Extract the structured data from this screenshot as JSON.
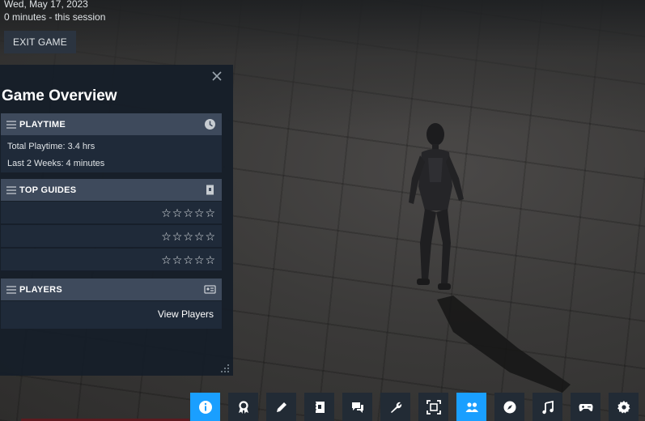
{
  "session": {
    "date": "Wed, May 17, 2023",
    "duration": "0 minutes - this session",
    "exit_label": "EXIT GAME"
  },
  "panel": {
    "title": "Game Overview",
    "close_icon": "close-icon",
    "sections": {
      "playtime": {
        "label": "PLAYTIME",
        "icon": "clock-icon",
        "total": "Total Playtime: 3.4 hrs",
        "recent": "Last 2 Weeks: 4 minutes"
      },
      "guides": {
        "label": "TOP GUIDES",
        "icon": "guide-book-icon",
        "rows": [
          {
            "stars": "☆☆☆☆☆",
            "rating": 0
          },
          {
            "stars": "☆☆☆☆☆",
            "rating": 0
          },
          {
            "stars": "☆☆☆☆☆",
            "rating": 0
          }
        ]
      },
      "players": {
        "label": "PLAYERS",
        "icon": "players-card-icon",
        "link": "View Players"
      }
    }
  },
  "taskbar": {
    "active_color": "#1a9fff",
    "items": [
      {
        "name": "info-icon",
        "active": true
      },
      {
        "name": "achievements-icon",
        "active": false
      },
      {
        "name": "notes-pencil-icon",
        "active": false
      },
      {
        "name": "guides-icon",
        "active": false
      },
      {
        "name": "discussions-icon",
        "active": false
      },
      {
        "name": "settings-wrench-icon",
        "active": false
      },
      {
        "name": "screenshot-icon",
        "active": false
      },
      {
        "name": "friends-icon",
        "active": true
      },
      {
        "name": "browser-compass-icon",
        "active": false
      },
      {
        "name": "music-icon",
        "active": false
      },
      {
        "name": "controller-icon",
        "active": false
      },
      {
        "name": "gear-icon",
        "active": false
      }
    ]
  }
}
